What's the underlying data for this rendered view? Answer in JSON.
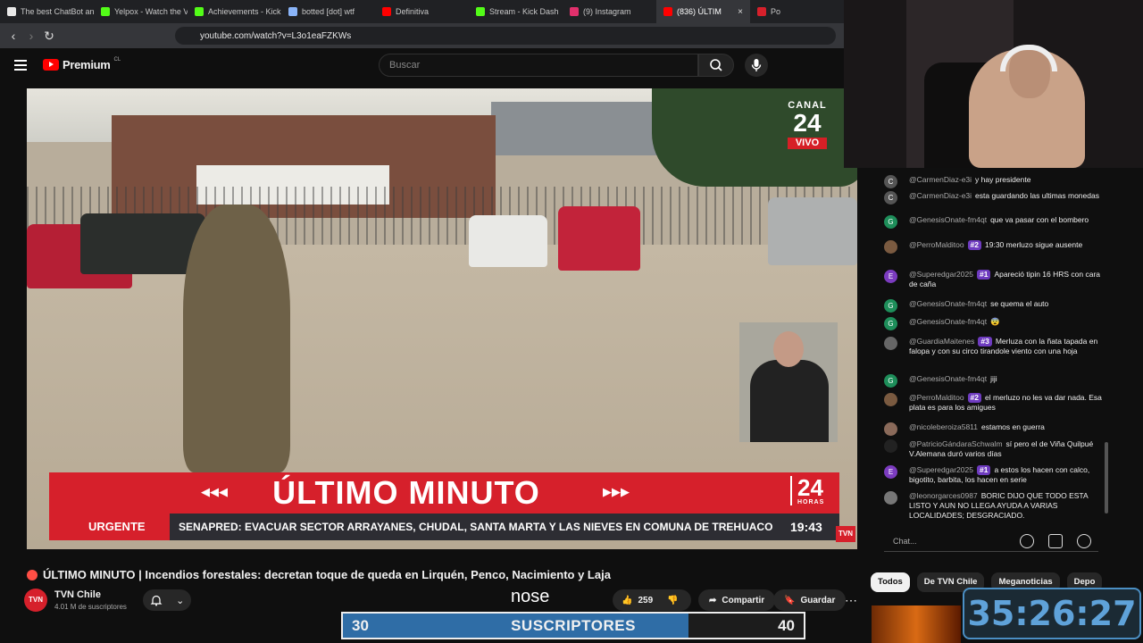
{
  "browser": {
    "tabs": [
      {
        "label": "The best ChatBot and",
        "color": "#e8e8e8"
      },
      {
        "label": "Yelpox - Watch the VO",
        "color": "#53fc18"
      },
      {
        "label": "Achievements - Kick D",
        "color": "#53fc18"
      },
      {
        "label": "botted [dot] wtf",
        "color": "#8ab4f8"
      },
      {
        "label": "Definitiva",
        "color": "#ff0000"
      },
      {
        "label": "Stream - Kick Dash",
        "color": "#53fc18"
      },
      {
        "label": "(9) Instagram",
        "color": "#e1306c"
      },
      {
        "label": "(836) ÚLTIM",
        "color": "#ff0000"
      },
      {
        "label": "Po",
        "color": "#d6202b"
      }
    ],
    "url": "youtube.com/watch?v=L3o1eaFZKWs"
  },
  "youtube": {
    "brand": "Premium",
    "region": "CL",
    "search_placeholder": "Buscar"
  },
  "video": {
    "channel_bug": {
      "line1": "CANAL",
      "line2": "24",
      "line3": "VIVO"
    },
    "banner_title": "ÚLTIMO MINUTO",
    "banner_brand": "24",
    "banner_brand_sub": "HORAS",
    "ticker_label": "URGENTE",
    "ticker_text": "SENAPRED: EVACUAR SECTOR ARRAYANES, CHUDAL, SANTA MARTA Y LAS NIEVES EN COMUNA DE TREHUACO",
    "ticker_time": "19:43",
    "corner_bug": "TVN"
  },
  "meta": {
    "title": "ÚLTIMO MINUTO | Incendios forestales: decretan toque de queda en Lirquén, Penco, Nacimiento y Laja",
    "channel": "TVN Chile",
    "avatar_text": "TVN",
    "subscribers": "4.01 M de suscriptores",
    "likes": "259",
    "share_label": "Compartir",
    "save_label": "Guardar"
  },
  "overlay": {
    "text": "nose",
    "sub_goal": {
      "from": "30",
      "label": "SUSCRIPTORES",
      "to": "40",
      "progress": 0.75
    },
    "timer": "35:26:27"
  },
  "chat": {
    "messages": [
      {
        "author": "@CarmenDiaz-e3i",
        "initial": "C",
        "color": "#555555",
        "text": "y hay presidente"
      },
      {
        "author": "@CarmenDiaz-e3i",
        "initial": "C",
        "color": "#555555",
        "text": "esta guardando las ultimas monedas"
      },
      {
        "author": "@GenesisOnate-fm4qt",
        "initial": "G",
        "color": "#1e8e5a",
        "text": "que va pasar con el bombero"
      },
      {
        "author": "@PerroMalditoo",
        "initial": "",
        "color": "#7a5a40",
        "badge": "#2",
        "text": "19:30 merluzo sigue ausente"
      },
      {
        "author": "@Superedgar2025",
        "initial": "E",
        "color": "#7b3bbf",
        "badge": "#1",
        "text": "Apareció tipin 16 HRS con cara de caña"
      },
      {
        "author": "@GenesisOnate-fm4qt",
        "initial": "G",
        "color": "#1e8e5a",
        "text": "se quema el auto"
      },
      {
        "author": "@GenesisOnate-fm4qt",
        "initial": "G",
        "color": "#1e8e5a",
        "text": "😨"
      },
      {
        "author": "@GuardiaMaitenes",
        "initial": "",
        "color": "#666666",
        "badge": "#3",
        "text": "Merluza con la ñata tapada en falopa y con su circo tirandole viento con una hoja"
      },
      {
        "author": "@GenesisOnate-fm4qt",
        "initial": "G",
        "color": "#1e8e5a",
        "text": "jiji"
      },
      {
        "author": "@PerroMalditoo",
        "initial": "",
        "color": "#7a5a40",
        "badge": "#2",
        "text": "el merluzo no les va dar nada. Esa plata es para los amigues"
      },
      {
        "author": "@nicoleberoiza5811",
        "initial": "",
        "color": "#8a6a5a",
        "text": "estamos en guerra"
      },
      {
        "author": "@PatricioGándaraSchwalm",
        "initial": "",
        "color": "#222222",
        "text": "sí pero el de Viña Quilpué V.Alemana duró varios días"
      },
      {
        "author": "@Superedgar2025",
        "initial": "E",
        "color": "#7b3bbf",
        "badge": "#1",
        "text": "a estos los hacen con calco, bigotito, barbita, los hacen en serie"
      },
      {
        "author": "@leonorgarces0987",
        "initial": "",
        "color": "#777777",
        "text": "BORIC DIJO QUE TODO ESTA LISTO Y AUN NO LLEGA AYUDA A VARIAS LOCALIDADES; DESGRACIADO."
      }
    ],
    "input_placeholder": "Chat...",
    "chips": [
      "Todos",
      "De TVN Chile",
      "Meganoticias",
      "Depo"
    ]
  }
}
